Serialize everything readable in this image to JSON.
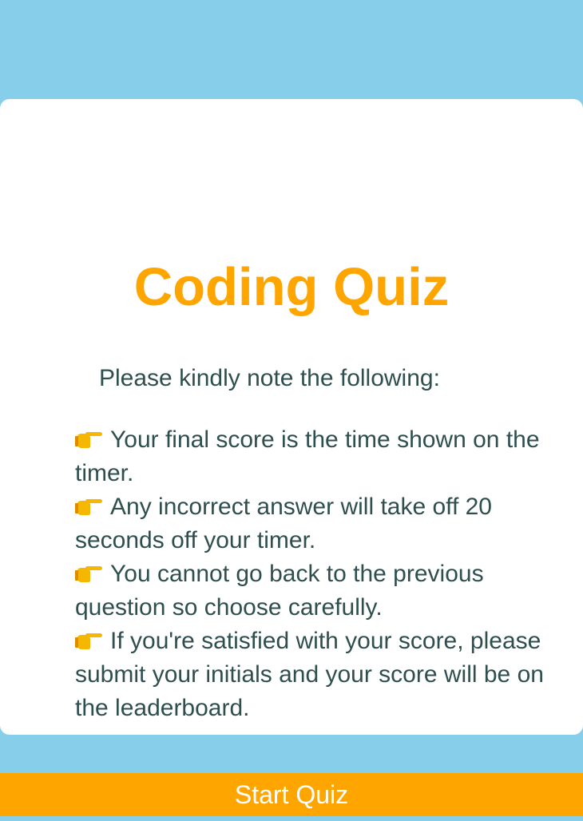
{
  "quiz": {
    "title": "Coding Quiz",
    "intro": "Please kindly note the following:",
    "rules": [
      {
        "icon": "pointing-hand-icon",
        "text": "Your final score is the time shown on the timer."
      },
      {
        "icon": "pointing-hand-icon",
        "text": "Any incorrect answer will take off 20 seconds off your timer."
      },
      {
        "icon": "pointing-hand-icon",
        "text": "You cannot go back to the previous question so choose carefully."
      },
      {
        "icon": "pointing-hand-icon",
        "text": "If you're satisfied with your score, please submit your initials and your score will be on the leaderboard."
      }
    ],
    "start_label": "Start Quiz"
  },
  "colors": {
    "background": "#87ceeb",
    "card": "#ffffff",
    "accent": "#ffa500",
    "text": "#2f4f4f",
    "button_text": "#ffffff"
  }
}
